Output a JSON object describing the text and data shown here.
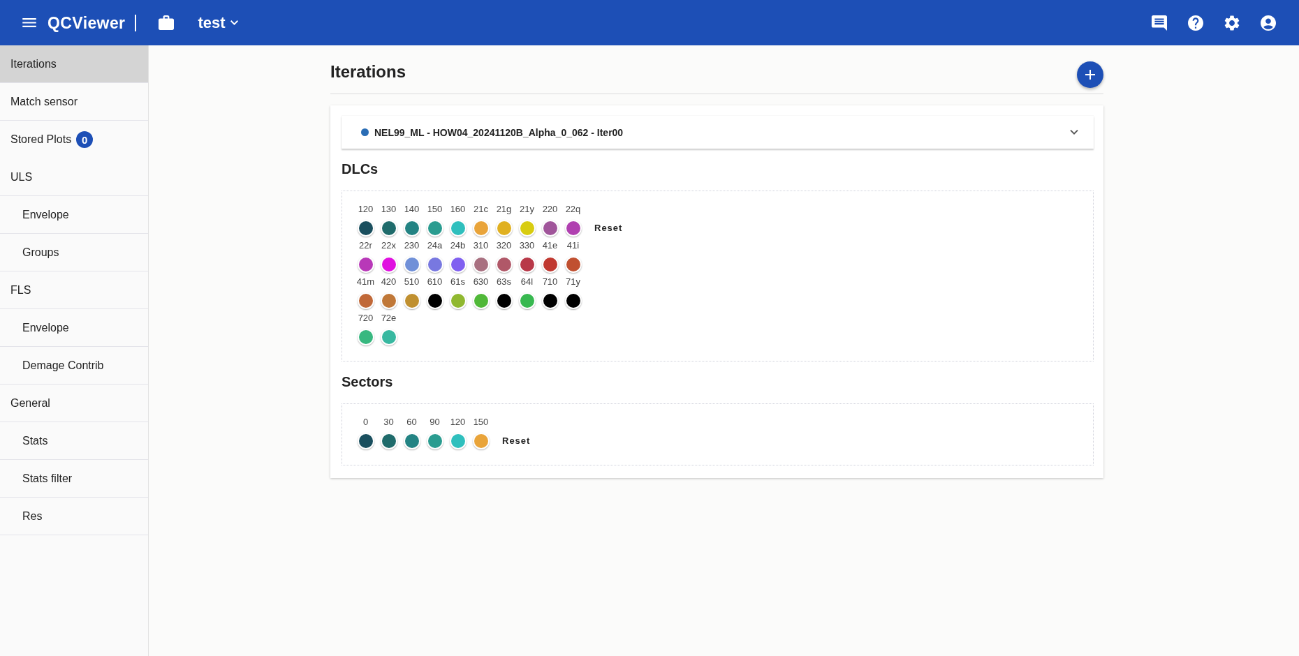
{
  "app_bar": {
    "title": "QCViewer",
    "project": "test"
  },
  "sidebar": {
    "items": [
      {
        "label": "Iterations",
        "selected": true
      },
      {
        "label": "Match sensor",
        "selected": false
      },
      {
        "label": "Stored Plots",
        "selected": false,
        "badge": "0"
      },
      {
        "label": "ULS",
        "selected": false,
        "children": [
          {
            "label": "Envelope",
            "selected": false
          },
          {
            "label": "Groups",
            "selected": false
          }
        ]
      },
      {
        "label": "FLS",
        "selected": false,
        "children": [
          {
            "label": "Envelope",
            "selected": false
          },
          {
            "label": "Demage Contrib",
            "selected": false
          }
        ]
      },
      {
        "label": "General",
        "selected": false,
        "children": [
          {
            "label": "Stats",
            "selected": false
          },
          {
            "label": "Stats filter",
            "selected": false
          },
          {
            "label": "Res",
            "selected": false
          }
        ]
      }
    ]
  },
  "page": {
    "title": "Iterations",
    "iterations": [
      {
        "label": "NEL99_ML - HOW04_20241120B_Alpha_0_062 - Iter00",
        "color": "#2a6db5",
        "expanded": false
      }
    ],
    "sections": [
      {
        "title": "DLCs",
        "reset": "Reset",
        "items": [
          {
            "label": "120",
            "color": "#1a4f5e"
          },
          {
            "label": "130",
            "color": "#1f6b6b"
          },
          {
            "label": "140",
            "color": "#238383"
          },
          {
            "label": "150",
            "color": "#2a9c90"
          },
          {
            "label": "160",
            "color": "#2fbfbd"
          },
          {
            "label": "21c",
            "color": "#e9a43a"
          },
          {
            "label": "21g",
            "color": "#e0b020"
          },
          {
            "label": "21y",
            "color": "#d8cc10"
          },
          {
            "label": "220",
            "color": "#a0559a"
          },
          {
            "label": "22q",
            "color": "#b040b0"
          },
          {
            "label": "22r",
            "color": "#b838b8"
          },
          {
            "label": "22x",
            "color": "#e010e0"
          },
          {
            "label": "230",
            "color": "#7090d8"
          },
          {
            "label": "24a",
            "color": "#7878e0"
          },
          {
            "label": "24b",
            "color": "#8060f0"
          },
          {
            "label": "310",
            "color": "#a87080"
          },
          {
            "label": "320",
            "color": "#b05868"
          },
          {
            "label": "330",
            "color": "#b83848"
          },
          {
            "label": "41e",
            "color": "#c03830"
          },
          {
            "label": "41i",
            "color": "#c05030"
          },
          {
            "label": "41m",
            "color": "#c06838"
          },
          {
            "label": "420",
            "color": "#c07838"
          },
          {
            "label": "510",
            "color": "#c09030"
          },
          {
            "label": "610",
            "color": "#000000"
          },
          {
            "label": "61s",
            "color": "#90b830"
          },
          {
            "label": "630",
            "color": "#50b838"
          },
          {
            "label": "63s",
            "color": "#000000"
          },
          {
            "label": "64l",
            "color": "#38b850"
          },
          {
            "label": "710",
            "color": "#000000"
          },
          {
            "label": "71y",
            "color": "#000000"
          },
          {
            "label": "720",
            "color": "#38b880"
          },
          {
            "label": "72e",
            "color": "#38b8a0"
          }
        ]
      },
      {
        "title": "Sectors",
        "reset": "Reset",
        "items": [
          {
            "label": "0",
            "color": "#1a4f5e"
          },
          {
            "label": "30",
            "color": "#1f6b6b"
          },
          {
            "label": "60",
            "color": "#238383"
          },
          {
            "label": "90",
            "color": "#2a9c90"
          },
          {
            "label": "120",
            "color": "#2fbfbd"
          },
          {
            "label": "150",
            "color": "#e9a43a"
          }
        ]
      }
    ]
  }
}
